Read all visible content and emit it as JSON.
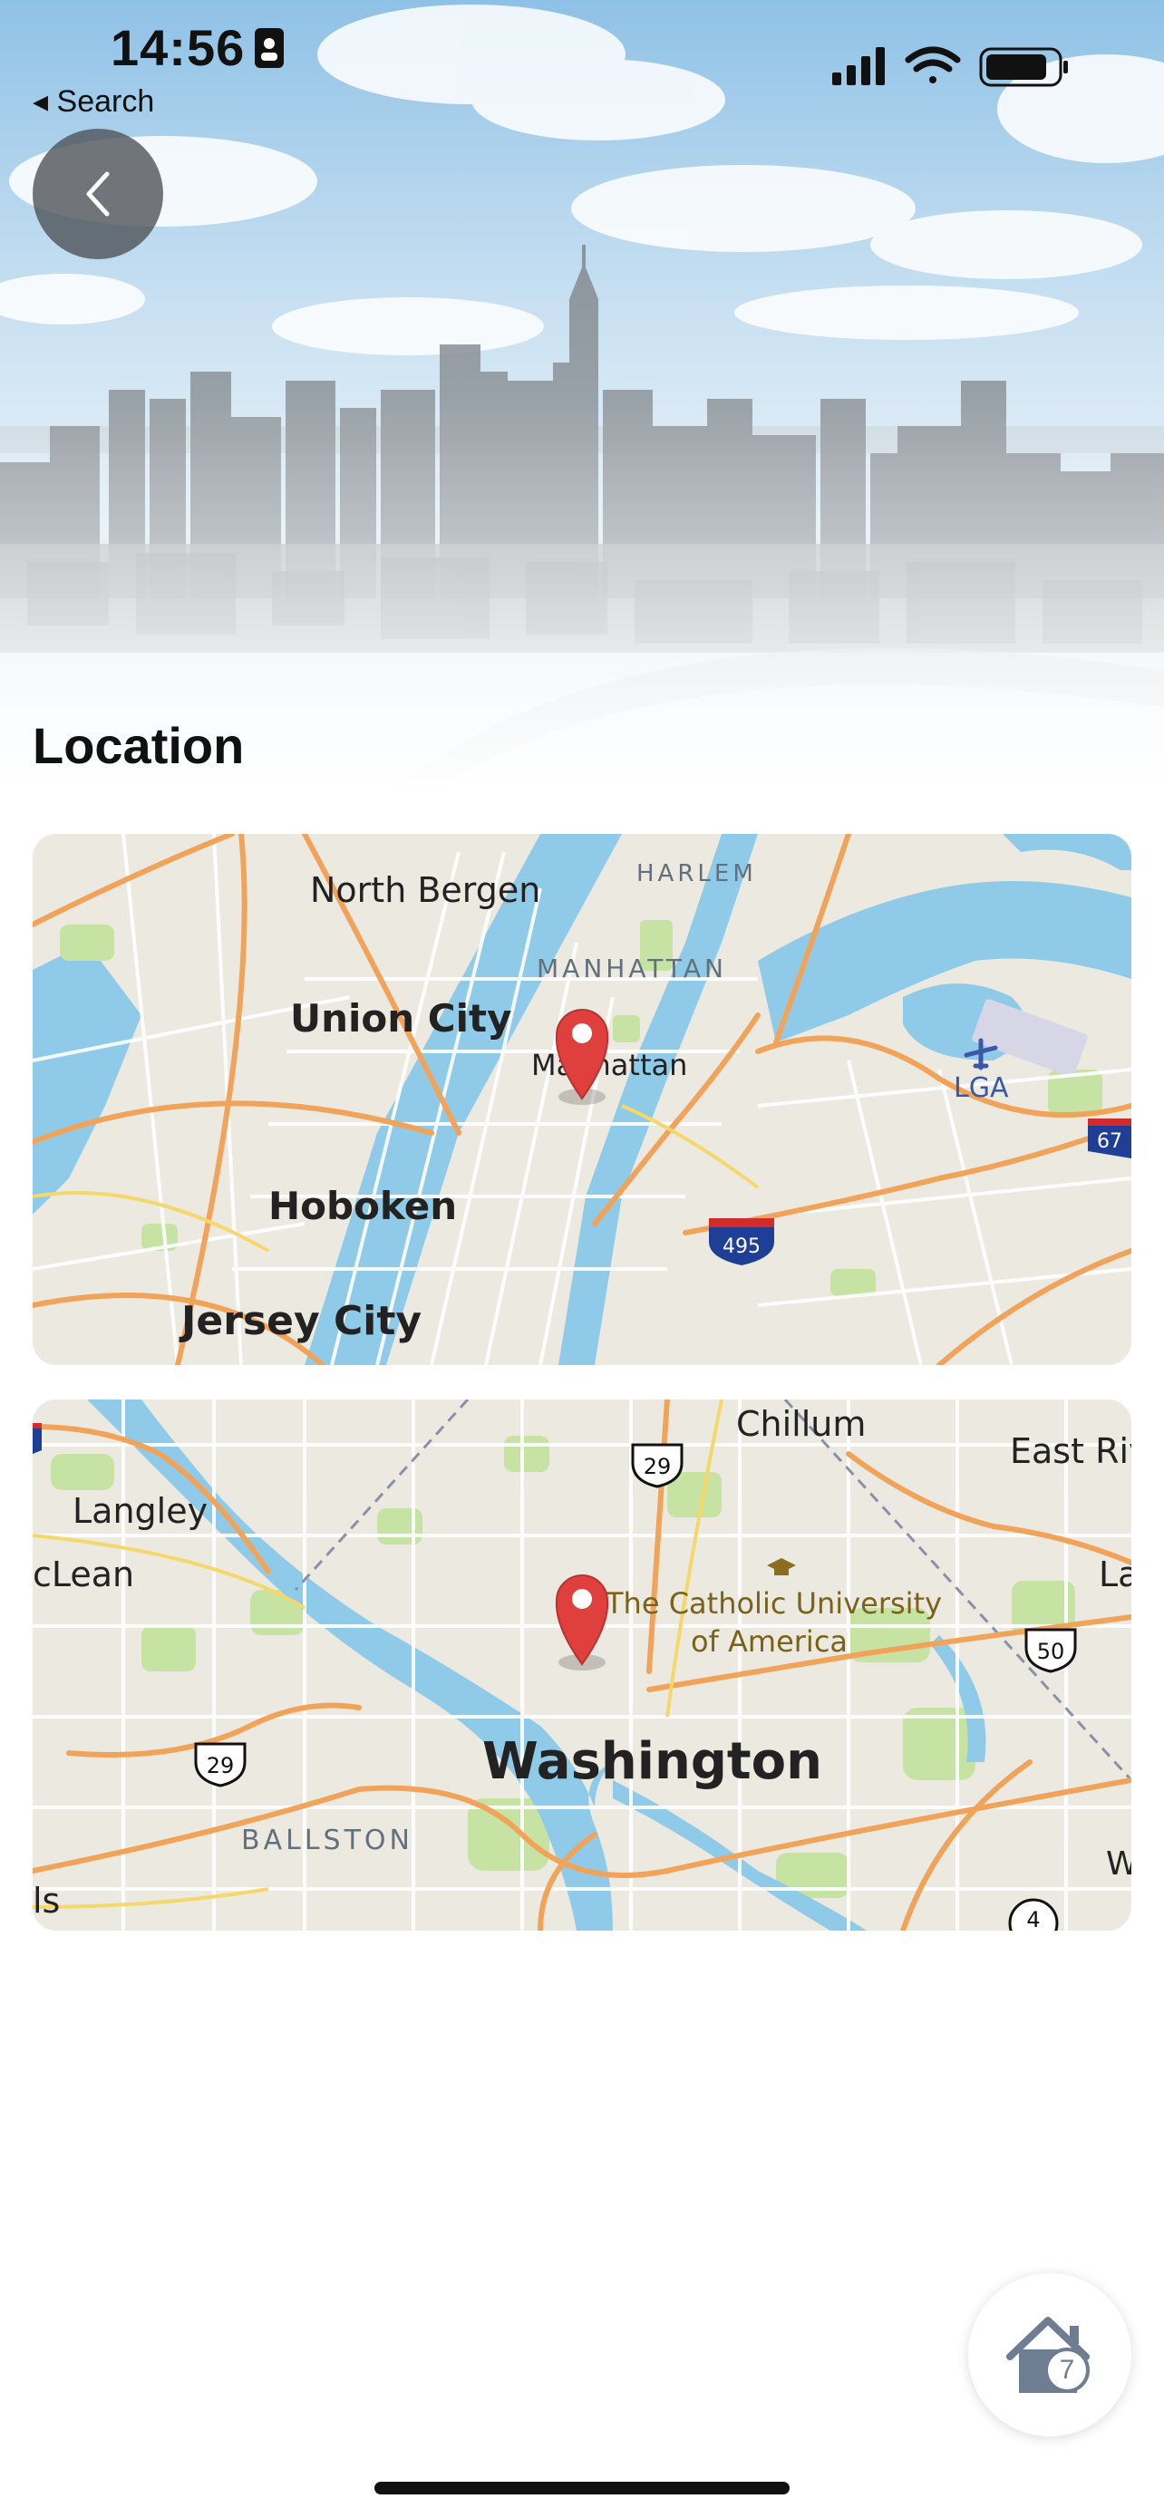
{
  "status_bar": {
    "time": "14:56",
    "back_to_app_label": "◂ Search",
    "signal_icon": "signal-bars-icon",
    "wifi_icon": "wifi-icon",
    "battery_icon": "battery-icon"
  },
  "hero": {
    "image": "city-skyline-photo",
    "back_button_icon": "chevron-left-icon"
  },
  "section": {
    "title": "Location"
  },
  "maps": [
    {
      "name": "manhattan",
      "pin_icon": "map-pin-icon",
      "labels": {
        "north_bergen": "North Bergen",
        "harlem": "HARLEM",
        "manhattan_district": "MANHATTAN",
        "union_city": "Union City",
        "manhattan": "Manhattan",
        "lga": "LGA",
        "hoboken": "Hoboken",
        "jersey_city": "Jersey City",
        "interstate": "495",
        "partial_route": "67"
      }
    },
    {
      "name": "washington",
      "pin_icon": "map-pin-icon",
      "labels": {
        "chillum": "Chillum",
        "east_riv": "East Riv",
        "langley": "Langley",
        "mclean": "cLean",
        "la": "La",
        "catholic_1": "The Catholic University",
        "catholic_2": "of America",
        "washington": "Washington",
        "ballston": "BALLSTON",
        "ls": "ls",
        "w": "W",
        "route_29a": "29",
        "route_29b": "29",
        "route_50": "50",
        "route_4": "4"
      }
    }
  ],
  "fab": {
    "icon": "home-icon",
    "count": "7"
  },
  "colors": {
    "water": "#8fcbe9",
    "land": "#ece9e1",
    "park": "#c6e3a4",
    "highway": "#f2a35a",
    "pin": "#e0403d",
    "overlay_button": "#4b5055"
  }
}
